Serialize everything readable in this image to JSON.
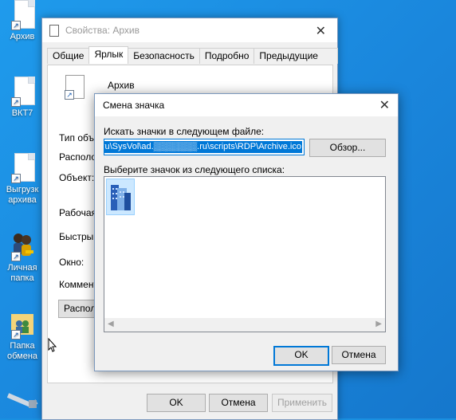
{
  "desktop": {
    "icons": [
      {
        "label": "Архив"
      },
      {
        "label": "ВКТ7"
      },
      {
        "label": "Выгрузк архива"
      },
      {
        "label": "Личная папка"
      },
      {
        "label": "Папка обмена"
      }
    ]
  },
  "properties_window": {
    "title": "Свойства: Архив",
    "tabs": [
      "Общие",
      "Ярлык",
      "Безопасность",
      "Подробно",
      "Предыдущие версии"
    ],
    "active_tab": "Ярлык",
    "shortcut_name": "Архив",
    "fields": {
      "target_type": "Тип объе",
      "target_location": "Располо",
      "target": "Объект:",
      "start_in": "Рабочая",
      "shortcut_key": "Быстрый",
      "run": "Окно:",
      "comment": "Коммент",
      "open_location_button": "Располо"
    },
    "buttons": {
      "ok": "OK",
      "cancel": "Отмена",
      "apply": "Применить"
    }
  },
  "change_icon_dialog": {
    "title": "Смена значка",
    "search_label": "Искать значки в следующем файле:",
    "path_value": "ı.ru\\SysVol\\ad.▒▒▒▒▒▒▒.ru\\scripts\\RDP\\Archive.ico",
    "browse_button": "Обзор...",
    "list_label": "Выберите значок из следующего списка:",
    "ok_button": "OK",
    "cancel_button": "Отмена"
  },
  "colors": {
    "accent": "#0078d7",
    "desktop": "#1a8fe0",
    "selection": "#cce8ff"
  }
}
